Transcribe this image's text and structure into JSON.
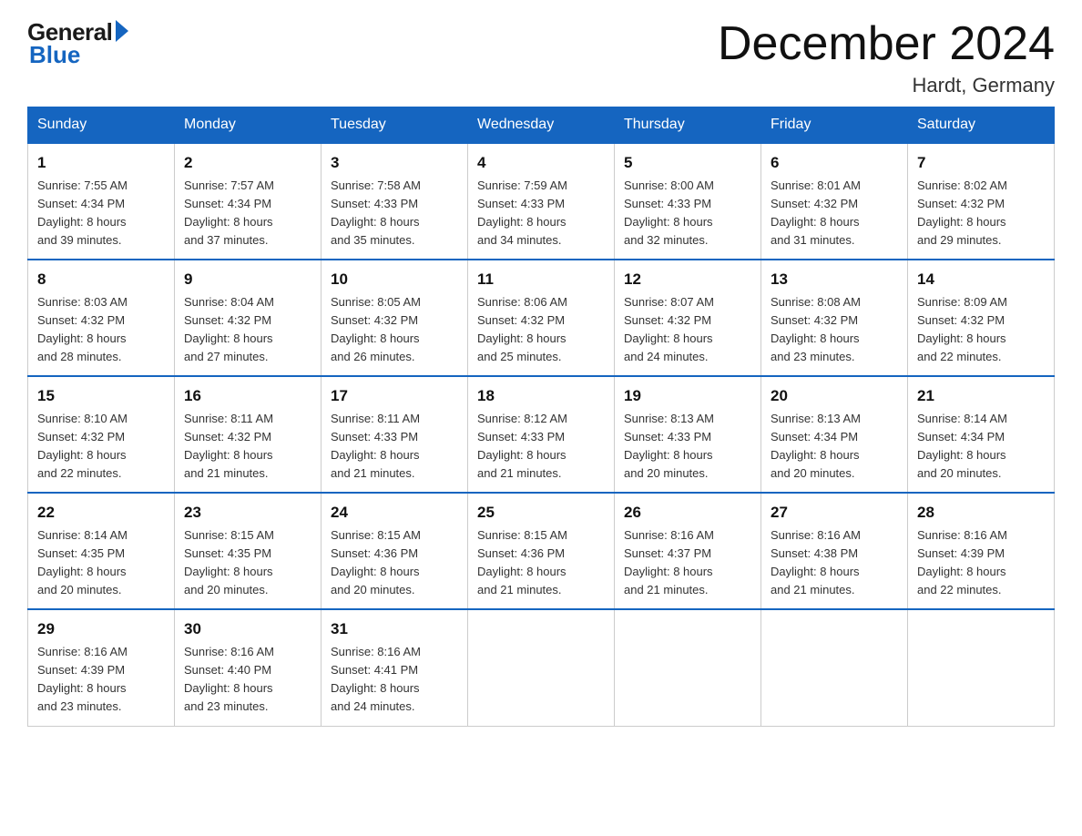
{
  "header": {
    "logo_general": "General",
    "logo_blue": "Blue",
    "month_title": "December 2024",
    "location": "Hardt, Germany"
  },
  "days_of_week": [
    "Sunday",
    "Monday",
    "Tuesday",
    "Wednesday",
    "Thursday",
    "Friday",
    "Saturday"
  ],
  "weeks": [
    [
      {
        "day": "1",
        "sunrise": "7:55 AM",
        "sunset": "4:34 PM",
        "daylight": "8 hours and 39 minutes."
      },
      {
        "day": "2",
        "sunrise": "7:57 AM",
        "sunset": "4:34 PM",
        "daylight": "8 hours and 37 minutes."
      },
      {
        "day": "3",
        "sunrise": "7:58 AM",
        "sunset": "4:33 PM",
        "daylight": "8 hours and 35 minutes."
      },
      {
        "day": "4",
        "sunrise": "7:59 AM",
        "sunset": "4:33 PM",
        "daylight": "8 hours and 34 minutes."
      },
      {
        "day": "5",
        "sunrise": "8:00 AM",
        "sunset": "4:33 PM",
        "daylight": "8 hours and 32 minutes."
      },
      {
        "day": "6",
        "sunrise": "8:01 AM",
        "sunset": "4:32 PM",
        "daylight": "8 hours and 31 minutes."
      },
      {
        "day": "7",
        "sunrise": "8:02 AM",
        "sunset": "4:32 PM",
        "daylight": "8 hours and 29 minutes."
      }
    ],
    [
      {
        "day": "8",
        "sunrise": "8:03 AM",
        "sunset": "4:32 PM",
        "daylight": "8 hours and 28 minutes."
      },
      {
        "day": "9",
        "sunrise": "8:04 AM",
        "sunset": "4:32 PM",
        "daylight": "8 hours and 27 minutes."
      },
      {
        "day": "10",
        "sunrise": "8:05 AM",
        "sunset": "4:32 PM",
        "daylight": "8 hours and 26 minutes."
      },
      {
        "day": "11",
        "sunrise": "8:06 AM",
        "sunset": "4:32 PM",
        "daylight": "8 hours and 25 minutes."
      },
      {
        "day": "12",
        "sunrise": "8:07 AM",
        "sunset": "4:32 PM",
        "daylight": "8 hours and 24 minutes."
      },
      {
        "day": "13",
        "sunrise": "8:08 AM",
        "sunset": "4:32 PM",
        "daylight": "8 hours and 23 minutes."
      },
      {
        "day": "14",
        "sunrise": "8:09 AM",
        "sunset": "4:32 PM",
        "daylight": "8 hours and 22 minutes."
      }
    ],
    [
      {
        "day": "15",
        "sunrise": "8:10 AM",
        "sunset": "4:32 PM",
        "daylight": "8 hours and 22 minutes."
      },
      {
        "day": "16",
        "sunrise": "8:11 AM",
        "sunset": "4:32 PM",
        "daylight": "8 hours and 21 minutes."
      },
      {
        "day": "17",
        "sunrise": "8:11 AM",
        "sunset": "4:33 PM",
        "daylight": "8 hours and 21 minutes."
      },
      {
        "day": "18",
        "sunrise": "8:12 AM",
        "sunset": "4:33 PM",
        "daylight": "8 hours and 21 minutes."
      },
      {
        "day": "19",
        "sunrise": "8:13 AM",
        "sunset": "4:33 PM",
        "daylight": "8 hours and 20 minutes."
      },
      {
        "day": "20",
        "sunrise": "8:13 AM",
        "sunset": "4:34 PM",
        "daylight": "8 hours and 20 minutes."
      },
      {
        "day": "21",
        "sunrise": "8:14 AM",
        "sunset": "4:34 PM",
        "daylight": "8 hours and 20 minutes."
      }
    ],
    [
      {
        "day": "22",
        "sunrise": "8:14 AM",
        "sunset": "4:35 PM",
        "daylight": "8 hours and 20 minutes."
      },
      {
        "day": "23",
        "sunrise": "8:15 AM",
        "sunset": "4:35 PM",
        "daylight": "8 hours and 20 minutes."
      },
      {
        "day": "24",
        "sunrise": "8:15 AM",
        "sunset": "4:36 PM",
        "daylight": "8 hours and 20 minutes."
      },
      {
        "day": "25",
        "sunrise": "8:15 AM",
        "sunset": "4:36 PM",
        "daylight": "8 hours and 21 minutes."
      },
      {
        "day": "26",
        "sunrise": "8:16 AM",
        "sunset": "4:37 PM",
        "daylight": "8 hours and 21 minutes."
      },
      {
        "day": "27",
        "sunrise": "8:16 AM",
        "sunset": "4:38 PM",
        "daylight": "8 hours and 21 minutes."
      },
      {
        "day": "28",
        "sunrise": "8:16 AM",
        "sunset": "4:39 PM",
        "daylight": "8 hours and 22 minutes."
      }
    ],
    [
      {
        "day": "29",
        "sunrise": "8:16 AM",
        "sunset": "4:39 PM",
        "daylight": "8 hours and 23 minutes."
      },
      {
        "day": "30",
        "sunrise": "8:16 AM",
        "sunset": "4:40 PM",
        "daylight": "8 hours and 23 minutes."
      },
      {
        "day": "31",
        "sunrise": "8:16 AM",
        "sunset": "4:41 PM",
        "daylight": "8 hours and 24 minutes."
      },
      null,
      null,
      null,
      null
    ]
  ],
  "labels": {
    "sunrise": "Sunrise: ",
    "sunset": "Sunset: ",
    "daylight": "Daylight: "
  }
}
